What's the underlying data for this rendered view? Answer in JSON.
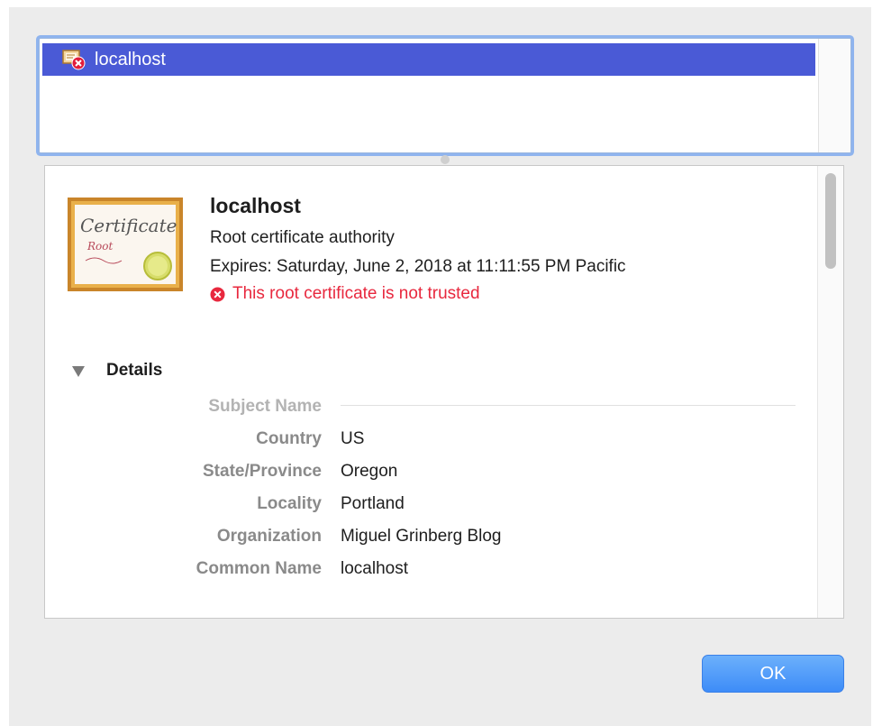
{
  "certificate_list": {
    "items": [
      {
        "label": "localhost",
        "icon": "certificate-untrusted-icon",
        "selected": true
      }
    ]
  },
  "certificate": {
    "name": "localhost",
    "type": "Root certificate authority",
    "expires": "Expires: Saturday, June 2, 2018 at 11:11:55 PM Pacific",
    "warning": "This root certificate is not trusted",
    "image_text": {
      "line1": "Certificate",
      "line2": "Root"
    }
  },
  "details": {
    "header": "Details",
    "section": "Subject Name",
    "fields": [
      {
        "key": "Country",
        "value": "US"
      },
      {
        "key": "State/Province",
        "value": "Oregon"
      },
      {
        "key": "Locality",
        "value": "Portland"
      },
      {
        "key": "Organization",
        "value": "Miguel Grinberg Blog"
      },
      {
        "key": "Common Name",
        "value": "localhost"
      }
    ]
  },
  "buttons": {
    "ok": "OK"
  },
  "colors": {
    "selection": "#4a5ad6",
    "warning": "#e8283e",
    "accent": "#3d8cf8"
  }
}
